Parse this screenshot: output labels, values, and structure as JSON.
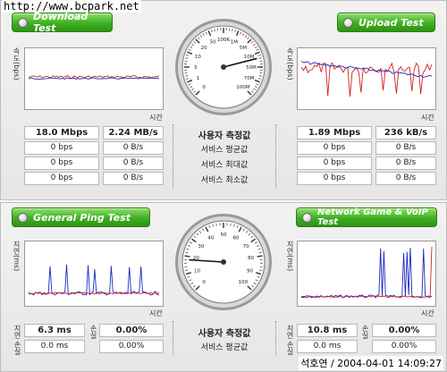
{
  "watermark": {
    "url": "http://www.bcpark.net",
    "signature": "석호연 / 2004-04-01 14:09:27"
  },
  "download": {
    "title": "Download Test",
    "y_label": "속도(bps)",
    "x_label": "시간",
    "measured_bps": "18.0 Mbps",
    "measured_Bps": "2.24 MB/s",
    "avg_bps": "0 bps",
    "avg_Bps": "0 B/s",
    "max_bps": "0 bps",
    "max_Bps": "0 B/s",
    "min_bps": "0 bps",
    "min_Bps": "0 B/s"
  },
  "upload": {
    "title": "Upload Test",
    "y_label": "속도(bps)",
    "x_label": "시간",
    "measured_bps": "1.89 Mbps",
    "measured_Bps": "236 kB/s",
    "avg_bps": "0 bps",
    "avg_Bps": "0 B/s",
    "max_bps": "0 bps",
    "max_Bps": "0 B/s",
    "min_bps": "0 bps",
    "min_Bps": "0 B/s"
  },
  "speed_center": {
    "measured": "사용자 측정값",
    "avg": "서비스 평균값",
    "max": "서비스 최대값",
    "min": "서비스 최소값"
  },
  "speed_gauge": {
    "ticks": [
      "0",
      "1",
      "5",
      "10",
      "20",
      "50",
      "100K",
      "1M",
      "5M",
      "10M",
      "50M",
      "70M",
      "100M"
    ],
    "needle_fraction": 0.78
  },
  "ping": {
    "title": "General Ping Test",
    "y_label": "지연(ms)",
    "x_label": "시간",
    "side_delay": "지연",
    "side_loss": "손실",
    "measured_ms": "6.3 ms",
    "measured_loss": "0.00%",
    "avg_ms": "0.0 ms",
    "avg_loss": "0.00%"
  },
  "game": {
    "title": "Network Game & VoIP Test",
    "y_label": "지연(ms)",
    "x_label": "시간",
    "side_delay": "지연",
    "side_loss": "손실",
    "measured_ms": "10.8 ms",
    "measured_loss": "0.00%",
    "avg_ms": "0.0 ms",
    "avg_loss": "0.00%"
  },
  "ping_center": {
    "measured": "사용자 측정값",
    "avg": "서비스 평균값"
  },
  "ping_gauge": {
    "ticks": [
      "0",
      "10",
      "20",
      "30",
      "40",
      "50",
      "60",
      "70",
      "80",
      "90",
      "100"
    ],
    "needle_fraction": 0.18
  },
  "colors": {
    "series_red": "#d42020",
    "series_blue": "#1a2bbf",
    "button_green": "#3fae22",
    "gauge_tick_red": "#d42020"
  },
  "icons": {
    "button_dot": "radio-dot-icon"
  }
}
